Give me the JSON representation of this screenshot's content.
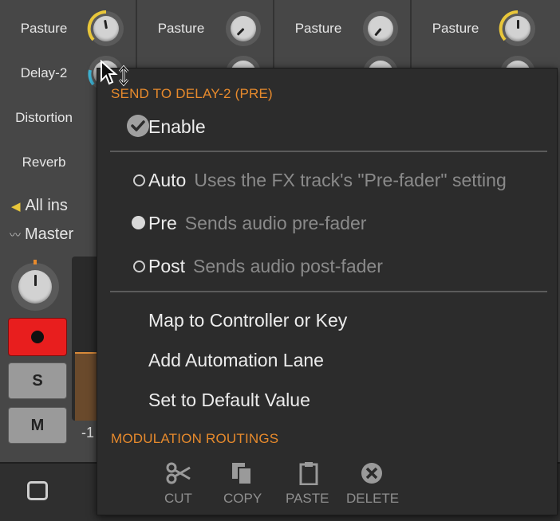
{
  "sends": {
    "pasture_label": "Pasture",
    "delay_label": "Delay-2",
    "distortion_label": "Distortion",
    "reverb_label": "Reverb"
  },
  "routing": {
    "input_label": "All ins",
    "output_label": "Master"
  },
  "meter_value": "-1",
  "buttons": {
    "solo": "S",
    "mute": "M"
  },
  "menu": {
    "title": "SEND TO DELAY-2 (PRE)",
    "enable": "Enable",
    "auto": "Auto",
    "auto_desc": "Uses the FX track's \"Pre-fader\" setting",
    "pre": "Pre",
    "pre_desc": "Sends audio pre-fader",
    "post": "Post",
    "post_desc": "Sends audio post-fader",
    "map": "Map to Controller or Key",
    "automation": "Add Automation Lane",
    "default": "Set to Default Value",
    "modulation_header": "MODULATION ROUTINGS",
    "cut": "CUT",
    "copy": "COPY",
    "paste": "PASTE",
    "delete": "DELETE",
    "selected_mode": "Pre",
    "enabled": true
  },
  "colors": {
    "accent_orange": "#e78a2c",
    "knob_yellow": "#e8c63a",
    "knob_cyan": "#3fb4d4",
    "record_red": "#e81e1e"
  }
}
